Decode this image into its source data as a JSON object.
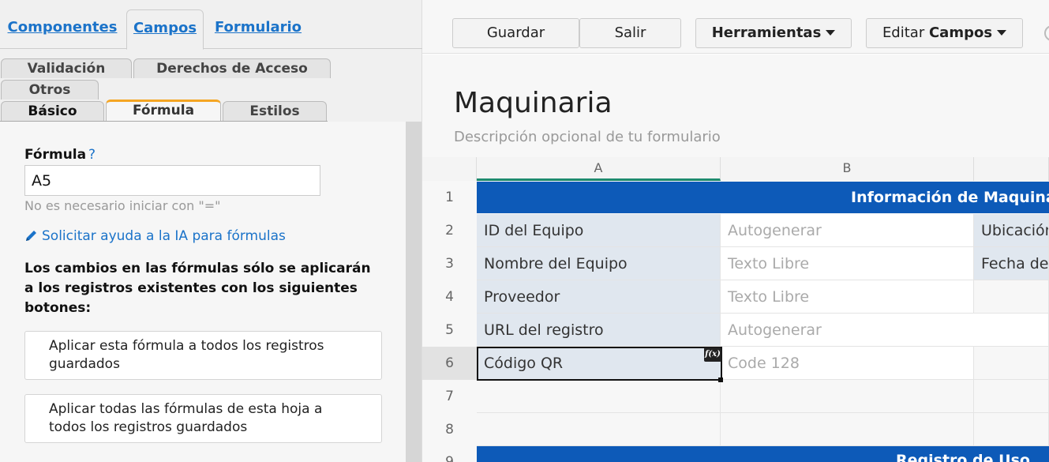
{
  "top_tabs": [
    {
      "label": "Componentes"
    },
    {
      "label": "Campos"
    },
    {
      "label": "Formulario"
    }
  ],
  "sub_tabs": [
    {
      "label": "Validación"
    },
    {
      "label": "Derechos de Acceso"
    },
    {
      "label": "Otros"
    },
    {
      "label": "Básico"
    },
    {
      "label": "Fórmula"
    },
    {
      "label": "Estilos"
    }
  ],
  "formula": {
    "label": "Fórmula",
    "help": "?",
    "value": "A5",
    "hint": "No es necesario iniciar con \"=\"",
    "ai_link": "Solicitar ayuda a la IA para fórmulas",
    "notice": "Los cambios en las fórmulas sólo se aplicarán a los registros existentes con los siguientes botones:",
    "apply_one": "Aplicar esta fórmula a todos los registros guardados",
    "apply_all": "Aplicar todas las fórmulas de esta hoja a todos los registros guardados"
  },
  "toolbar": {
    "save": "Guardar",
    "exit": "Salir",
    "tools": "Herramientas",
    "edit_prefix": "Editar",
    "edit_bold": "Campos"
  },
  "form": {
    "title": "Maquinaria",
    "description": "Descripción opcional de tu formulario"
  },
  "grid": {
    "columns": [
      "A",
      "B"
    ],
    "rows": [
      "1",
      "2",
      "3",
      "4",
      "5",
      "6",
      "7",
      "8",
      "9"
    ],
    "banner_1": "Información de Maquinaria",
    "banner_9": "Registro de Uso",
    "cells": {
      "a2": "ID del Equipo",
      "b2": "Autogenerar",
      "c2": "Ubicación",
      "a3": "Nombre del Equipo",
      "b3": "Texto Libre",
      "c3": "Fecha de",
      "a4": "Proveedor",
      "b4": "Texto Libre",
      "a5": "URL del registro",
      "b5": "Autogenerar",
      "a6": "Código QR",
      "b6": "Code 128"
    },
    "fx_badge": "f(x)"
  },
  "colors": {
    "link_blue": "#1b73c9",
    "banner_blue": "#0d5ab8",
    "tab_accent": "#f5a623",
    "label_cell": "#e0e7ef",
    "column_selected": "#1d8b6e"
  }
}
